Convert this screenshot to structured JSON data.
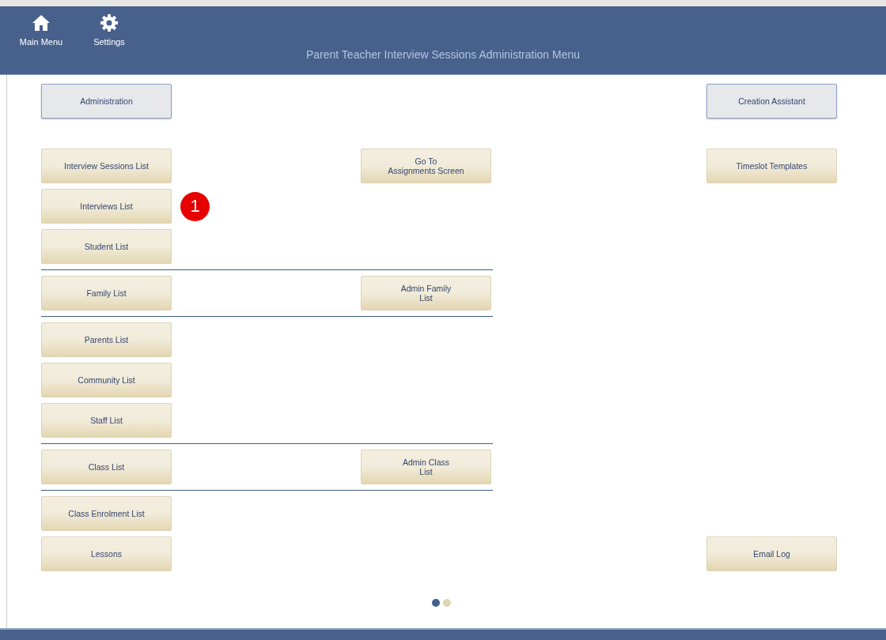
{
  "toolbar": {
    "items": [
      {
        "kind": "home",
        "label": "Main Menu"
      },
      {
        "kind": "settings",
        "label": "Settings"
      }
    ],
    "title": "Parent Teacher Interview Sessions Administration Menu"
  },
  "sections": [
    {
      "ruled_above": false,
      "rows": [
        {
          "left": {
            "label": "Administration",
            "kind": "admin"
          },
          "right": {
            "label": "Creation Assistant",
            "kind": "admin"
          }
        }
      ]
    },
    {
      "ruled_above": false,
      "rows": [
        {
          "left": {
            "label": "Interview Sessions List",
            "kind": "list"
          },
          "middle": {
            "label": "Go To\nAssignments Screen",
            "kind": "list"
          },
          "right": {
            "label": "Timeslot Templates",
            "kind": "list"
          }
        },
        {
          "left": {
            "label": "Interviews List",
            "kind": "list",
            "badge": "1"
          }
        },
        {
          "left": {
            "label": "Student List",
            "kind": "list"
          }
        }
      ]
    },
    {
      "ruled_above": true,
      "rows": [
        {
          "left": {
            "label": "Family List",
            "kind": "list"
          },
          "middle": {
            "label": "Admin Family\nList",
            "kind": "list"
          }
        }
      ]
    },
    {
      "ruled_above": true,
      "rows": [
        {
          "left": {
            "label": "Parents List",
            "kind": "list"
          }
        },
        {
          "left": {
            "label": "Community List",
            "kind": "list"
          }
        },
        {
          "left": {
            "label": "Staff List",
            "kind": "list"
          }
        }
      ]
    },
    {
      "ruled_above": true,
      "rows": [
        {
          "left": {
            "label": "Class List",
            "kind": "list"
          },
          "middle": {
            "label": "Admin Class\nList",
            "kind": "list"
          }
        }
      ]
    },
    {
      "ruled_above": true,
      "rows": [
        {
          "left": {
            "label": "Class Enrolment List",
            "kind": "list"
          }
        },
        {
          "left": {
            "label": "Lessons",
            "kind": "list"
          },
          "right": {
            "label": "Email Log",
            "kind": "list"
          }
        }
      ]
    }
  ],
  "pages": [
    {
      "selected": true
    },
    {
      "selected": false
    }
  ]
}
